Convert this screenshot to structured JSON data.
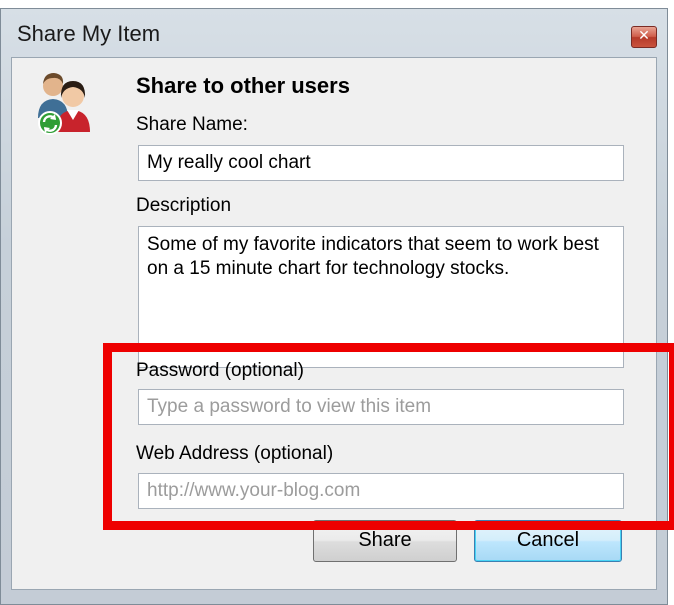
{
  "window": {
    "title": "Share My Item",
    "close_glyph": "✕"
  },
  "icons": {
    "users": "users-share-icon",
    "close": "close-icon"
  },
  "dialog": {
    "heading": "Share to other users",
    "share_name_label": "Share Name:",
    "share_name_value": "My really cool chart",
    "description_label": "Description",
    "description_value": "Some of my favorite indicators that seem to work best on a 15 minute chart for technology stocks.",
    "password_label": "Password (optional)",
    "password_placeholder": "Type a password to view this item",
    "password_value": "",
    "web_address_label": "Web Address (optional)",
    "web_address_placeholder": "http://www.your-blog.com",
    "web_address_value": ""
  },
  "buttons": {
    "share": "Share",
    "cancel": "Cancel"
  },
  "colors": {
    "highlight": "#ee0000",
    "default_button_border": "#3c7fb1"
  }
}
